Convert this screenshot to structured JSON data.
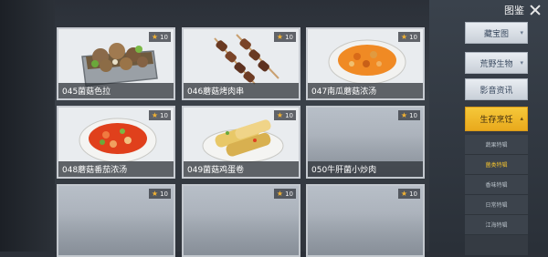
{
  "header": {
    "title": "图鉴"
  },
  "cards": [
    {
      "label": "045菌菇色拉",
      "level": "10"
    },
    {
      "label": "046蘑菇烤肉串",
      "level": "10"
    },
    {
      "label": "047南瓜蘑菇浓汤",
      "level": "10"
    },
    {
      "label": "048蘑菇番茄浓汤",
      "level": "10"
    },
    {
      "label": "049菌菇鸡蛋卷",
      "level": "10"
    },
    {
      "label": "050牛肝菌小炒肉",
      "level": "10"
    },
    {
      "label": "",
      "level": "10"
    },
    {
      "label": "",
      "level": "10"
    },
    {
      "label": "",
      "level": "10"
    }
  ],
  "menu": {
    "items": [
      {
        "label": "藏宝图"
      },
      {
        "label": "荒野生物"
      },
      {
        "label": "影音资讯"
      },
      {
        "label": "生存烹饪"
      }
    ],
    "sub_items": [
      {
        "label": "蔬果特辑"
      },
      {
        "label": "菌类特辑"
      },
      {
        "label": "香味特辑"
      },
      {
        "label": "日常特辑"
      },
      {
        "label": "江海特辑"
      }
    ]
  },
  "colors": {
    "accent": "#f2b233",
    "active_tab": "#e9a91c"
  }
}
